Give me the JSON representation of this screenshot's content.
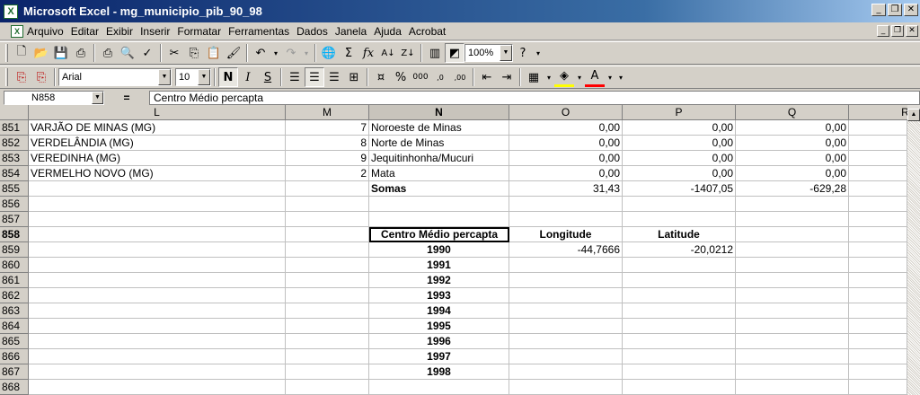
{
  "window": {
    "title": "Microsoft Excel - mg_municipio_pib_90_98",
    "app_icon": "X"
  },
  "menu": [
    "Arquivo",
    "Editar",
    "Exibir",
    "Inserir",
    "Formatar",
    "Ferramentas",
    "Dados",
    "Janela",
    "Ajuda",
    "Acrobat"
  ],
  "toolbar": {
    "zoom": "100%",
    "font": "Arial",
    "size": "10"
  },
  "formula_bar": {
    "name_box": "N858",
    "equals": "=",
    "content": "Centro Médio percapta"
  },
  "columns": [
    "L",
    "M",
    "N",
    "O",
    "P",
    "Q",
    "R"
  ],
  "rows": [
    {
      "num": "851",
      "L": "VARJÃO DE MINAS (MG)",
      "M": "7",
      "N": "Noroeste de Minas",
      "O": "0,00",
      "P": "0,00",
      "Q": "0,00"
    },
    {
      "num": "852",
      "L": "VERDELÂNDIA (MG)",
      "M": "8",
      "N": "Norte de Minas",
      "O": "0,00",
      "P": "0,00",
      "Q": "0,00"
    },
    {
      "num": "853",
      "L": "VEREDINHA (MG)",
      "M": "9",
      "N": "Jequitinhonha/Mucuri",
      "O": "0,00",
      "P": "0,00",
      "Q": "0,00"
    },
    {
      "num": "854",
      "L": "VERMELHO NOVO (MG)",
      "M": "2",
      "N": "Mata",
      "O": "0,00",
      "P": "0,00",
      "Q": "0,00"
    },
    {
      "num": "855",
      "L": "",
      "M": "",
      "N": "Somas",
      "O": "31,43",
      "P": "-1407,05",
      "Q": "-629,28"
    },
    {
      "num": "856",
      "L": "",
      "M": "",
      "N": "",
      "O": "",
      "P": "",
      "Q": ""
    },
    {
      "num": "857",
      "L": "",
      "M": "",
      "N": "",
      "O": "",
      "P": "",
      "Q": ""
    },
    {
      "num": "858",
      "L": "",
      "M": "",
      "N": "Centro Médio percapta",
      "O": "Longitude",
      "P": "Latitude",
      "Q": ""
    },
    {
      "num": "859",
      "L": "",
      "M": "",
      "N": "1990",
      "O": "-44,7666",
      "P": "-20,0212",
      "Q": ""
    },
    {
      "num": "860",
      "L": "",
      "M": "",
      "N": "1991",
      "O": "",
      "P": "",
      "Q": ""
    },
    {
      "num": "861",
      "L": "",
      "M": "",
      "N": "1992",
      "O": "",
      "P": "",
      "Q": ""
    },
    {
      "num": "862",
      "L": "",
      "M": "",
      "N": "1993",
      "O": "",
      "P": "",
      "Q": ""
    },
    {
      "num": "863",
      "L": "",
      "M": "",
      "N": "1994",
      "O": "",
      "P": "",
      "Q": ""
    },
    {
      "num": "864",
      "L": "",
      "M": "",
      "N": "1995",
      "O": "",
      "P": "",
      "Q": ""
    },
    {
      "num": "865",
      "L": "",
      "M": "",
      "N": "1996",
      "O": "",
      "P": "",
      "Q": ""
    },
    {
      "num": "866",
      "L": "",
      "M": "",
      "N": "1997",
      "O": "",
      "P": "",
      "Q": ""
    },
    {
      "num": "867",
      "L": "",
      "M": "",
      "N": "1998",
      "O": "",
      "P": "",
      "Q": ""
    },
    {
      "num": "868",
      "L": "",
      "M": "",
      "N": "",
      "O": "",
      "P": "",
      "Q": ""
    }
  ]
}
